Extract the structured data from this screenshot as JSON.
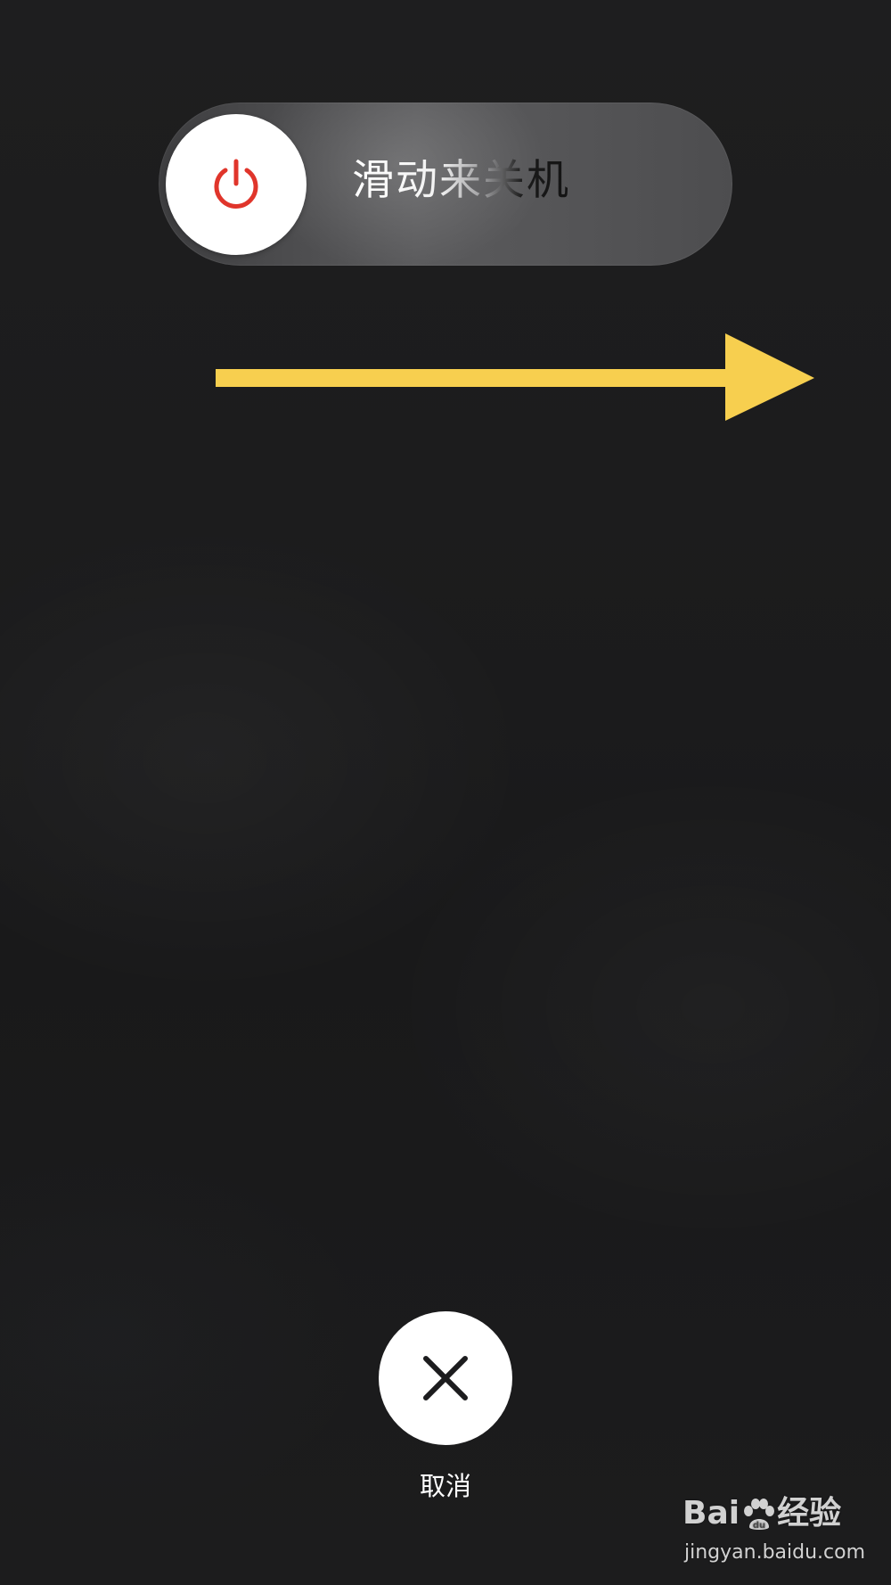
{
  "power_slider": {
    "label": "滑动来关机",
    "knob_icon": "power-icon",
    "knob_icon_color": "#e0352b"
  },
  "annotation": {
    "arrow_icon": "right-arrow-icon",
    "arrow_color": "#f7cf4f"
  },
  "cancel": {
    "label": "取消",
    "icon": "close-icon"
  },
  "watermark": {
    "brand_left": "Bai",
    "brand_right": "经验",
    "url": "jingyan.baidu.com"
  }
}
